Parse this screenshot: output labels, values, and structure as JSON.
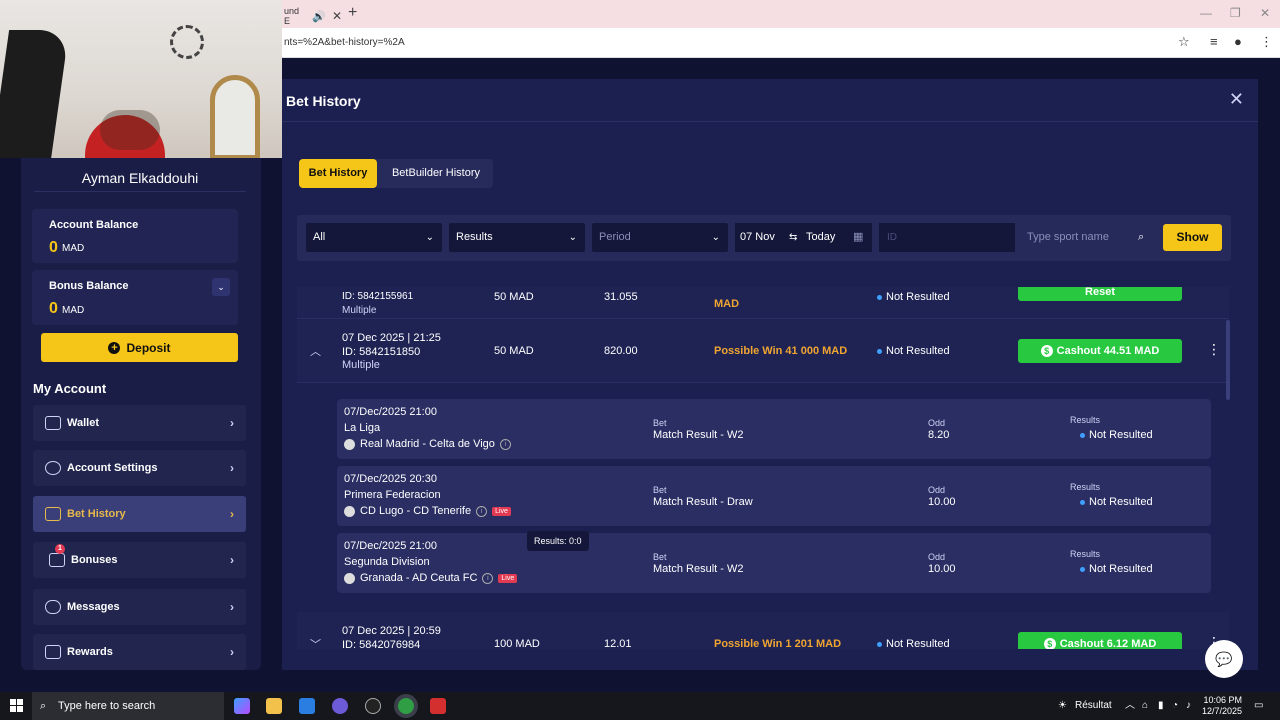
{
  "browser": {
    "tab_partial": "und E",
    "url": "nts=%2A&bet-history=%2A"
  },
  "user": {
    "name": "Ayman Elkaddouhi"
  },
  "account_balance": {
    "label": "Account Balance",
    "value": "0",
    "currency": "MAD"
  },
  "bonus_balance": {
    "label": "Bonus Balance",
    "value": "0",
    "currency": "MAD"
  },
  "deposit_label": "Deposit",
  "my_account_title": "My Account",
  "menu": [
    {
      "label": "Wallet"
    },
    {
      "label": "Account Settings"
    },
    {
      "label": "Bet History"
    },
    {
      "label": "Bonuses",
      "badge": "1"
    },
    {
      "label": "Messages"
    },
    {
      "label": "Rewards"
    }
  ],
  "modal": {
    "title": "Bet History",
    "tabs": [
      "Bet History",
      "BetBuilder History"
    ],
    "filters": {
      "type": "All",
      "results": "Results",
      "period": "Period",
      "date_from": "07 Nov",
      "date_to": "Today",
      "id_placeholder": "ID",
      "sport_placeholder": "Type sport name",
      "show": "Show"
    }
  },
  "bets": [
    {
      "id": "ID: 5842155961",
      "type": "Multiple",
      "stake": "50 MAD",
      "odd": "31.055",
      "possible": "MAD",
      "status": "Not Resulted",
      "cashout": "Reset"
    },
    {
      "datetime": "07 Dec 2025 | 21:25",
      "id": "ID: 5842151850",
      "type": "Multiple",
      "stake": "50 MAD",
      "odd": "820.00",
      "possible": "Possible Win 41 000 MAD",
      "status": "Not Resulted",
      "cashout": "Cashout 44.51 MAD"
    },
    {
      "datetime": "07 Dec 2025 | 20:59",
      "id": "ID: 5842076984",
      "stake": "100 MAD",
      "odd": "12.01",
      "possible": "Possible Win 1 201 MAD",
      "status": "Not Resulted",
      "cashout": "Cashout 6.12 MAD"
    }
  ],
  "selections": [
    {
      "datetime": "07/Dec/2025 21:00",
      "league": "La Liga",
      "match": "Real Madrid - Celta de Vigo",
      "bet_label": "Bet",
      "bet": "Match Result - W2",
      "odd_label": "Odd",
      "odd": "8.20",
      "results_label": "Results",
      "result": "Not Resulted"
    },
    {
      "datetime": "07/Dec/2025 20:30",
      "league": "Primera Federacion",
      "match": "CD Lugo - CD Tenerife",
      "live": "Live",
      "bet_label": "Bet",
      "bet": "Match Result - Draw",
      "odd_label": "Odd",
      "odd": "10.00",
      "results_label": "Results",
      "result": "Not Resulted"
    },
    {
      "datetime": "07/Dec/2025 21:00",
      "league": "Segunda Division",
      "match": "Granada - AD Ceuta FC",
      "live": "Live",
      "bet_label": "Bet",
      "bet": "Match Result - W2",
      "odd_label": "Odd",
      "odd": "10.00",
      "results_label": "Results",
      "result": "Not Resulted"
    }
  ],
  "tooltip": "Results: 0:0",
  "taskbar": {
    "search_placeholder": "Type here to search",
    "weather": "Résultat",
    "time": "10:06 PM",
    "date": "12/7/2025"
  }
}
